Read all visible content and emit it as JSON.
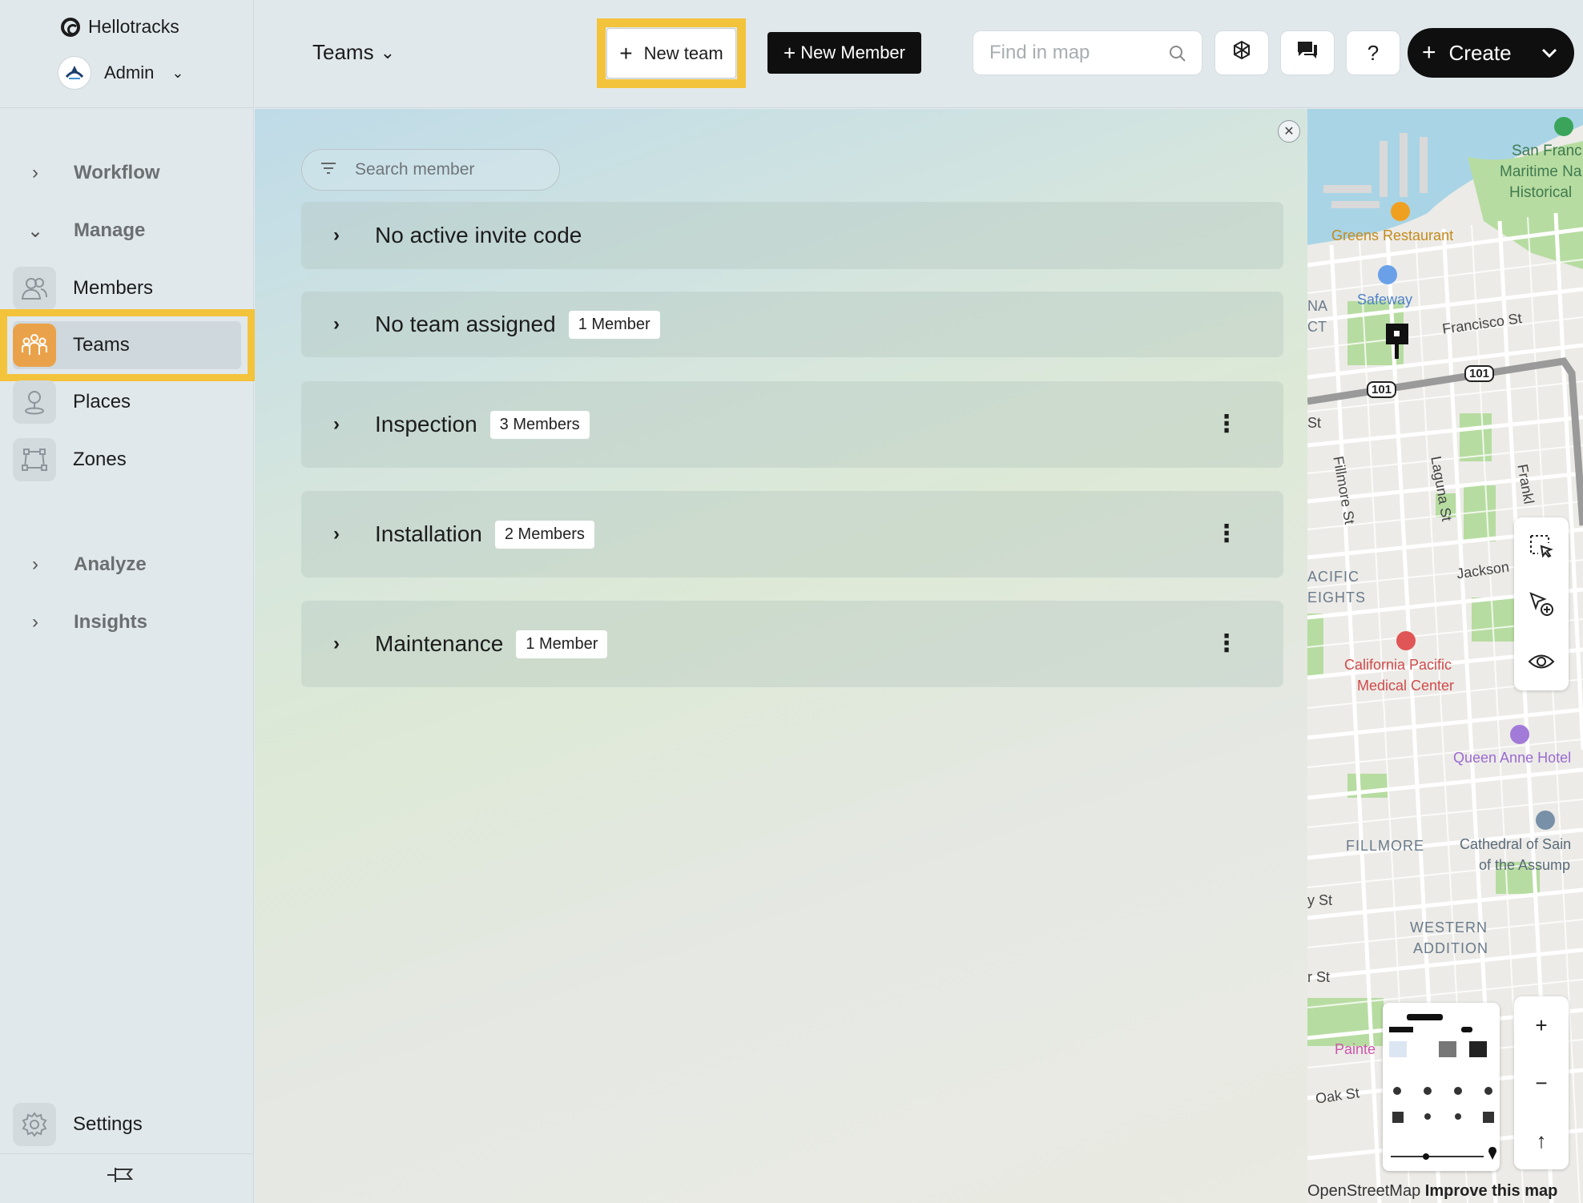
{
  "sidebar": {
    "brand": "Hellotracks",
    "account": "Admin",
    "sections": {
      "workflow": "Workflow",
      "manage": "Manage",
      "analyze": "Analyze",
      "insights": "Insights"
    },
    "items": [
      {
        "label": "Members",
        "icon": "members-icon"
      },
      {
        "label": "Teams",
        "icon": "teams-icon",
        "active": true
      },
      {
        "label": "Places",
        "icon": "places-icon"
      },
      {
        "label": "Zones",
        "icon": "zones-icon"
      }
    ],
    "settings": "Settings"
  },
  "topbar": {
    "page": "Teams",
    "new_team": "New team",
    "new_member": "New Member",
    "find_placeholder": "Find in map",
    "help": "?",
    "create": "Create"
  },
  "panel": {
    "search_placeholder": "Search member",
    "groups": [
      {
        "name": "No active invite code",
        "badge": null
      },
      {
        "name": "No team assigned",
        "badge": "1 Member"
      },
      {
        "name": "Inspection",
        "badge": "3 Members"
      },
      {
        "name": "Installation",
        "badge": "2 Members"
      },
      {
        "name": "Maintenance",
        "badge": "1 Member"
      }
    ]
  },
  "map": {
    "labels": {
      "san_fran_1": "San Franc",
      "san_fran_2": "Maritime Na",
      "san_fran_3": "Historical",
      "greens": "Greens Restaurant",
      "safeway": "Safeway",
      "francisco": "Francisco St",
      "hw1": "101",
      "hw2": "101",
      "fillmore_st": "Fillmore St",
      "laguna": "Laguna St",
      "frankl": "Frankl",
      "jackson": "Jackson",
      "pacific_1": "ACIFIC",
      "pacific_2": "EIGHTS",
      "cpmc_1": "California Pacific",
      "cpmc_2": "Medical Center",
      "queen_anne": "Queen Anne Hotel",
      "fillmore": "FILLMORE",
      "cathedral_1": "Cathedral of Sain",
      "cathedral_2": "of the Assump",
      "western_1": "WESTERN",
      "western_2": "ADDITION",
      "oak": "Oak St",
      "painted": "Painte",
      "na": "NA",
      "ct": "CT",
      "st1": "St",
      "st2": "y St",
      "st3": "r St"
    },
    "attribution": "OpenStreetMap",
    "improve": "Improve this map"
  },
  "colors": {
    "highlight": "#f3c33c",
    "active_icon": "#eaa24a",
    "dark_button": "#0f0f0f"
  }
}
